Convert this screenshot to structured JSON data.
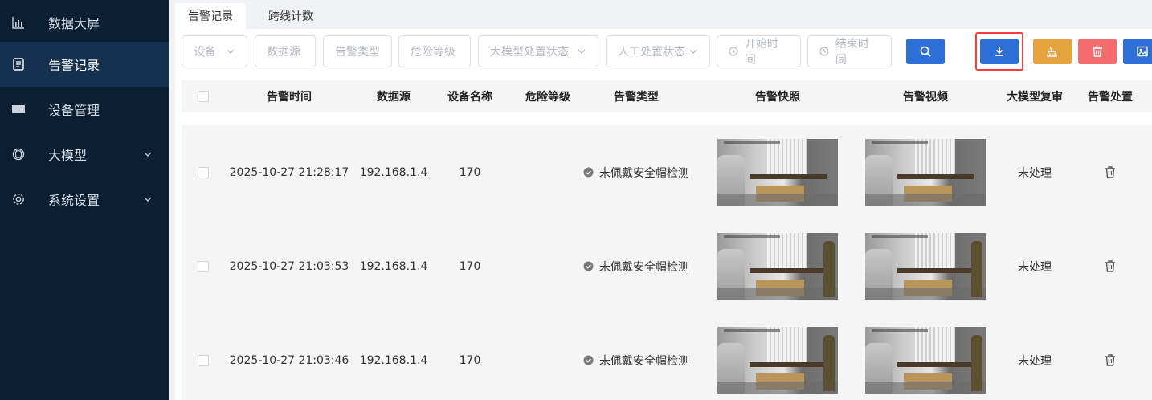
{
  "sidebar": {
    "items": [
      {
        "label": "数据大屏",
        "icon": "bar-chart-icon"
      },
      {
        "label": "告警记录",
        "icon": "document-list-icon",
        "active": true
      },
      {
        "label": "设备管理",
        "icon": "device-icon"
      },
      {
        "label": "大模型",
        "icon": "model-icon",
        "expandable": true
      },
      {
        "label": "系统设置",
        "icon": "gear-icon",
        "expandable": true
      }
    ]
  },
  "tabs": [
    {
      "label": "告警记录",
      "active": true
    },
    {
      "label": "跨线计数",
      "active": false
    }
  ],
  "filters": {
    "device": "设备",
    "datasource": "数据源",
    "alarm_type": "告警类型",
    "danger_level": "危险等级",
    "llm_status": "大模型处置状态",
    "manual_status": "人工处置状态",
    "start_time": "开始时间",
    "end_time": "结束时间"
  },
  "toolbar": {
    "search": "search-icon",
    "export": "download-icon",
    "clean": "broom-icon",
    "delete": "trash-icon",
    "image": "image-icon"
  },
  "colors": {
    "primary": "#2b6fd6",
    "warning": "#e6a23c",
    "danger": "#f56c6c",
    "sidebar": "#0b1f33",
    "highlight": "#ff3b3b"
  },
  "table": {
    "headers": {
      "time": "告警时间",
      "datasource": "数据源",
      "device": "设备名称",
      "level": "危险等级",
      "type": "告警类型",
      "snapshot": "告警快照",
      "video": "告警视频",
      "llm_review": "大模型复审",
      "action": "告警处置"
    },
    "rows": [
      {
        "time": "2025-10-27 21:28:17",
        "datasource": "192.168.1.4",
        "device": "170",
        "level": "",
        "type": "未佩戴安全帽检测",
        "llm_review": "未处理"
      },
      {
        "time": "2025-10-27 21:03:53",
        "datasource": "192.168.1.4",
        "device": "170",
        "level": "",
        "type": "未佩戴安全帽检测",
        "llm_review": "未处理"
      },
      {
        "time": "2025-10-27 21:03:46",
        "datasource": "192.168.1.4",
        "device": "170",
        "level": "",
        "type": "未佩戴安全帽检测",
        "llm_review": "未处理"
      }
    ]
  }
}
